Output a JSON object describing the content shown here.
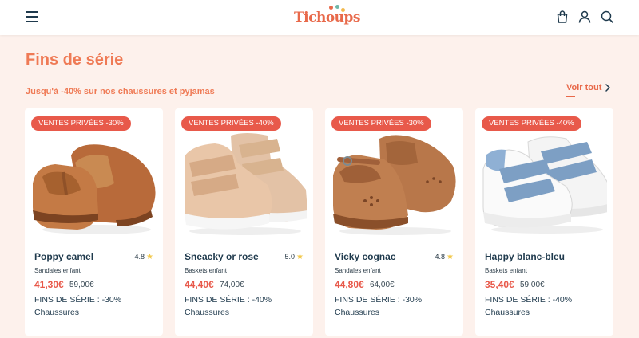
{
  "header": {
    "logo_text": "Tichoups",
    "icons": [
      "menu-icon",
      "bag-icon",
      "user-icon",
      "search-icon"
    ]
  },
  "section": {
    "title": "Fins de série",
    "subtitle": "Jusqu'à -40% sur nos chaussures et pyjamas",
    "see_all": "Voir tout"
  },
  "colors": {
    "accent": "#ef7a55",
    "badge": "#e8594a",
    "text": "#1f3a4d",
    "background": "#fdf1ec"
  },
  "products": [
    {
      "badge": "VENTES PRIVÉES -30%",
      "name": "Poppy camel",
      "rating": "4.8",
      "category": "Sandales enfant",
      "price": "41,30€",
      "old_price": "59,00€",
      "promo": "FINS DE SÉRIE : -30%",
      "type": "Chaussures"
    },
    {
      "badge": "VENTES PRIVÉES -40%",
      "name": "Sneacky or rose",
      "rating": "5.0",
      "category": "Baskets enfant",
      "price": "44,40€",
      "old_price": "74,00€",
      "promo": "FINS DE SÉRIE : -40%",
      "type": "Chaussures"
    },
    {
      "badge": "VENTES PRIVÉES -30%",
      "name": "Vicky cognac",
      "rating": "4.8",
      "category": "Sandales enfant",
      "price": "44,80€",
      "old_price": "64,00€",
      "promo": "FINS DE SÉRIE : -30%",
      "type": "Chaussures"
    },
    {
      "badge": "VENTES PRIVÉES -40%",
      "name": "Happy blanc-bleu",
      "rating": "",
      "category": "Baskets enfant",
      "price": "35,40€",
      "old_price": "59,00€",
      "promo": "FINS DE SÉRIE : -40%",
      "type": "Chaussures"
    }
  ]
}
